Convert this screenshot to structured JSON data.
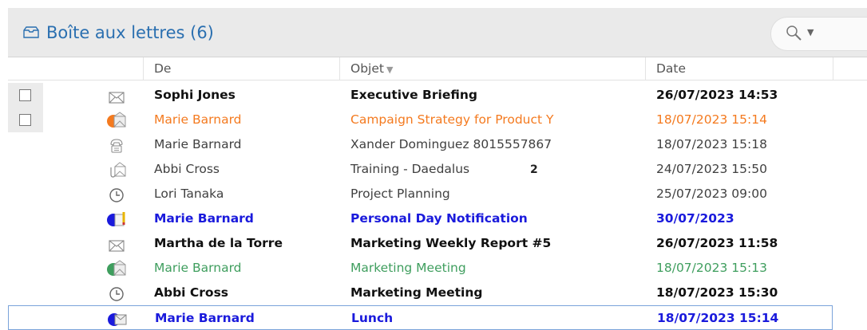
{
  "mailbox": {
    "title": "Boîte aux lettres (6)"
  },
  "columns": {
    "from": "De",
    "subject": "Objet",
    "date": "Date"
  },
  "colors": {
    "orange": "#f47a1f",
    "blue": "#1a1adc",
    "green": "#3f9e5e",
    "normal": "#404040",
    "title": "#2a6fb0"
  },
  "rows": [
    {
      "from": "Sophi Jones",
      "subject": "Executive Briefing",
      "date": "26/07/2023 14:53",
      "style": "bold",
      "icon": "envelope-icon",
      "checkbox": true
    },
    {
      "from": "Marie Barnard",
      "subject": "Campaign Strategy for Product Y",
      "date": "18/07/2023 15:14",
      "style": "orange",
      "icon": "orange-envelope-icon",
      "checkbox": true
    },
    {
      "from": "Marie Barnard",
      "subject": "Xander Dominguez 8015557867",
      "date": "18/07/2023 15:18",
      "style": "normal",
      "icon": "phone-icon",
      "checkbox": false
    },
    {
      "from": "Abbi Cross",
      "subject": "Training - Daedalus",
      "date": "24/07/2023 15:50",
      "style": "normal",
      "icon": "attachment-envelope-icon",
      "checkbox": false,
      "marker": "2"
    },
    {
      "from": "Lori Tanaka",
      "subject": "Project Planning",
      "date": "25/07/2023 09:00",
      "style": "normal",
      "icon": "clock-icon",
      "checkbox": false
    },
    {
      "from": "Marie Barnard",
      "subject": "Personal Day Notification",
      "date": "30/07/2023",
      "style": "blue",
      "icon": "blue-note-icon",
      "checkbox": false
    },
    {
      "from": "Martha de la Torre",
      "subject": "Marketing Weekly Report #5",
      "date": "26/07/2023 11:58",
      "style": "bold",
      "icon": "envelope-icon",
      "checkbox": false
    },
    {
      "from": "Marie Barnard",
      "subject": "Marketing Meeting",
      "date": "18/07/2023 15:13",
      "style": "green",
      "icon": "green-envelope-icon",
      "checkbox": false
    },
    {
      "from": "Abbi Cross",
      "subject": "Marketing Meeting",
      "date": "18/07/2023 15:30",
      "style": "bold",
      "icon": "clock-icon",
      "checkbox": false
    },
    {
      "from": "Marie Barnard",
      "subject": "Lunch",
      "date": "18/07/2023 15:14",
      "style": "blue",
      "icon": "blue-envelope-icon",
      "checkbox": false,
      "current": true
    }
  ]
}
